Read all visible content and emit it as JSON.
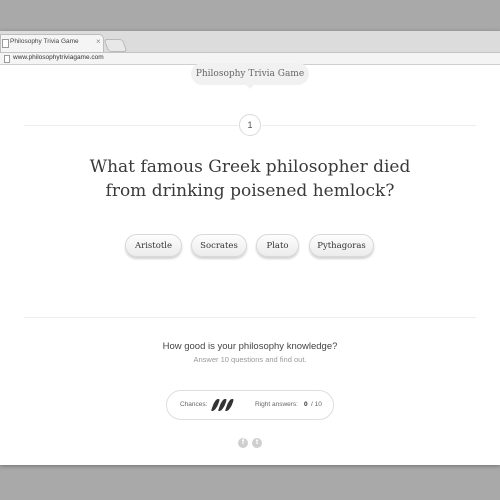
{
  "browser": {
    "tab_title": "Philosophy Trivia Game",
    "tab_close": "×",
    "url": "www.philosophytriviagame.com"
  },
  "game": {
    "title": "Philosophy Trivia Game",
    "question_number": "1",
    "question_line1": "What famous Greek philosopher died",
    "question_line2": "from drinking poisened hemlock?",
    "answers": [
      "Aristotle",
      "Socrates",
      "Plato",
      "Pythagoras"
    ]
  },
  "footer": {
    "tagline": "How good is your philosophy knowledge?",
    "subline": "Answer 10 questions and find out.",
    "chances_label": "Chances:",
    "chances_remaining": 3,
    "right_answers_label": "Right answers:",
    "right_answers": "0",
    "total": "/ 10"
  },
  "social": {
    "facebook_glyph": "f",
    "twitter_glyph": "t"
  },
  "colors": {
    "backdrop": "#a9a9a9",
    "page": "#ffffff",
    "accent_text": "#3a3a3a"
  }
}
